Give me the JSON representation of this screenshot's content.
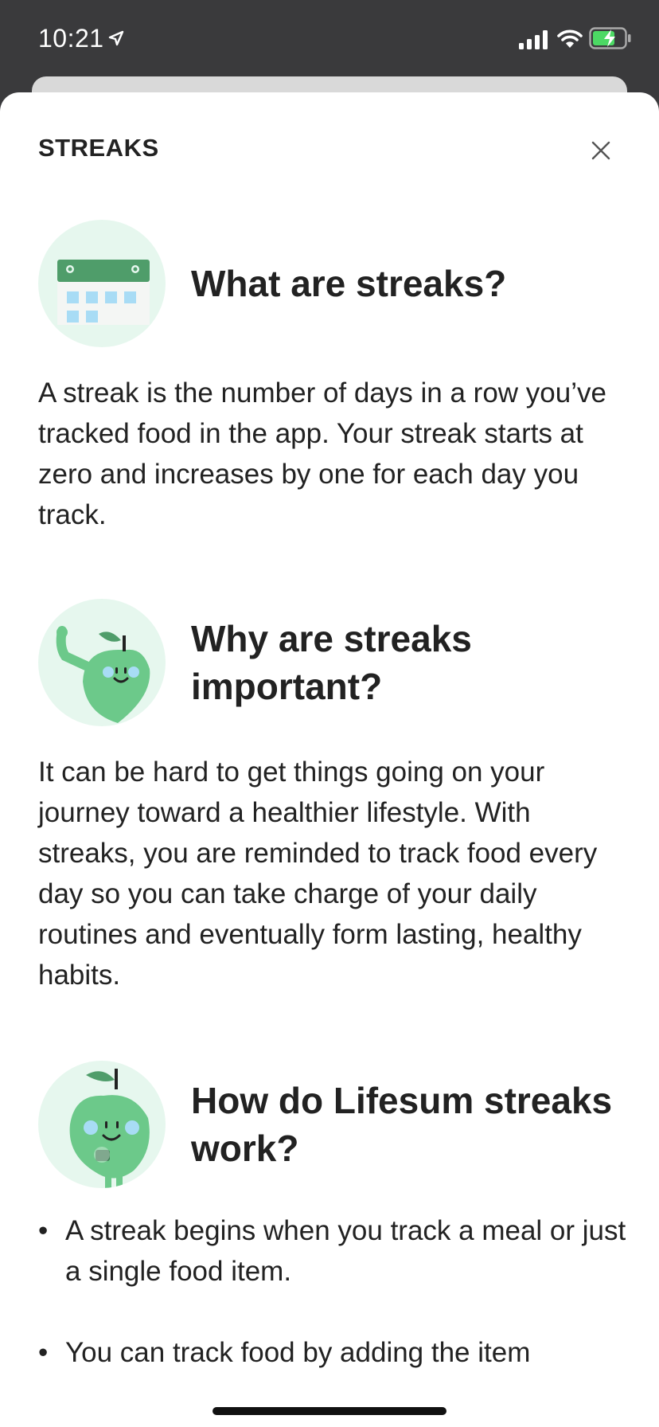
{
  "status_bar": {
    "time": "10:21",
    "icons": [
      "location-arrow-icon",
      "cellular-signal-icon",
      "wifi-icon",
      "battery-charging-icon"
    ],
    "battery_color": "#4cd964"
  },
  "sheet": {
    "title": "STREAKS",
    "close_icon": "close-icon"
  },
  "sections": [
    {
      "icon": "calendar-icon",
      "heading": "What are streaks?",
      "body": "A streak is the number of days in a row you’ve tracked food in the app. Your streak starts at zero and increases by one for each day you track."
    },
    {
      "icon": "waving-apple-icon",
      "heading": "Why are streaks important?",
      "body": "It can be hard to get things going on your journey toward a healthier lifestyle. With streaks, you are reminded to track food every day so you can take charge of your daily routines and eventually form lasting, healthy habits."
    },
    {
      "icon": "apple-phone-icon",
      "heading": "How do Lifesum streaks work?",
      "bullets": [
        "A streak begins when you track a meal or just a single food item.",
        "You can track food by adding the item"
      ]
    }
  ],
  "colors": {
    "accent_green": "#6cc98a",
    "icon_bg": "#e6f7ee",
    "calendar_header": "#4f9d6a",
    "calendar_cell": "#a8dcf5"
  }
}
